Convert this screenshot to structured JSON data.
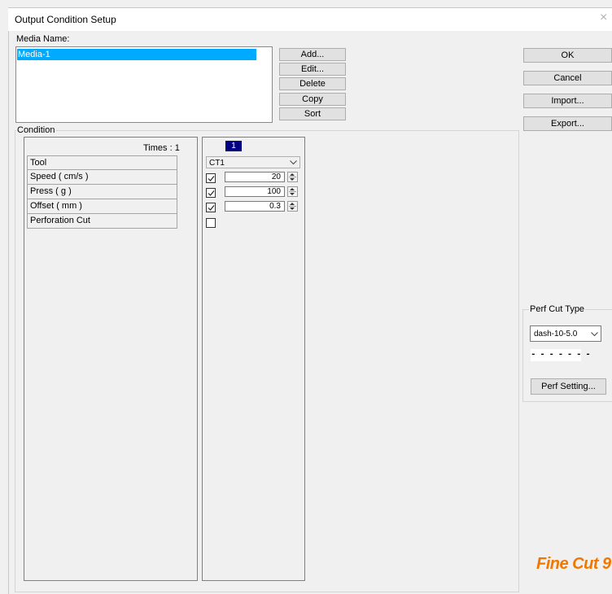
{
  "window": {
    "title": "Output Condition Setup",
    "close_glyph": "×"
  },
  "media": {
    "label": "Media Name:",
    "items": [
      "Media-1"
    ],
    "buttons": {
      "add": "Add...",
      "edit": "Edit...",
      "delete": "Delete",
      "copy": "Copy",
      "sort": "Sort"
    }
  },
  "dialog_buttons": {
    "ok": "OK",
    "cancel": "Cancel",
    "import": "Import...",
    "export": "Export..."
  },
  "condition": {
    "label": "Condition",
    "times_label": "Times : 1",
    "rows": [
      "Tool",
      "Speed ( cm/s )",
      "Press ( g )",
      "Offset ( mm )",
      "Perforation Cut"
    ],
    "column_number": "1",
    "tool_value": "CT1",
    "speed": {
      "checked": true,
      "value": "20"
    },
    "press": {
      "checked": true,
      "value": "100"
    },
    "offset": {
      "checked": true,
      "value": "0.3"
    },
    "perforation": {
      "checked": false
    }
  },
  "perf": {
    "label": "Perf Cut Type",
    "type_value": "dash-10-5.0",
    "preview": "- - - - - - -",
    "setting_button": "Perf Setting..."
  },
  "brand": {
    "logo_text": "Fine Cut 9"
  },
  "colors": {
    "selection": "#00aaff",
    "column_tab": "#000080",
    "logo": "#f07800"
  }
}
